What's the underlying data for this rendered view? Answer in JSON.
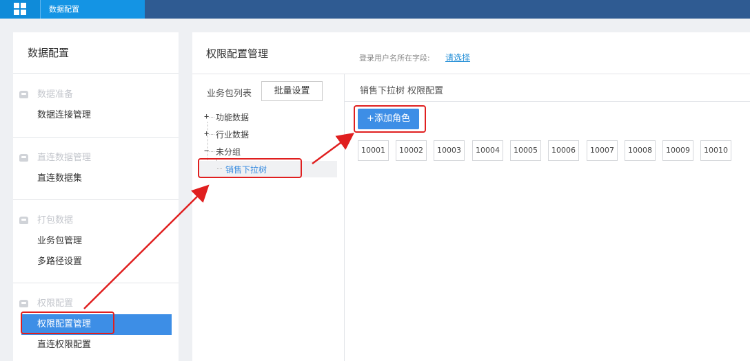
{
  "topbar": {
    "tab_label": "数据配置"
  },
  "sidebar": {
    "title": "数据配置",
    "groups": [
      {
        "header": "数据准备",
        "items": [
          "数据连接管理"
        ]
      },
      {
        "header": "直连数据管理",
        "items": [
          "直连数据集"
        ]
      },
      {
        "header": "打包数据",
        "items": [
          "业务包管理",
          "多路径设置"
        ]
      },
      {
        "header": "权限配置",
        "items": [
          "权限配置管理",
          "直连权限配置"
        ]
      }
    ]
  },
  "main": {
    "title": "权限配置管理",
    "login_field_label": "登录用户名所在字段:",
    "login_field_link": "请选择",
    "biz_list_label": "业务包列表",
    "batch_button": "批量设置",
    "tree": [
      "功能数据",
      "行业数据",
      "未分组"
    ],
    "tree_selected": "销售下拉树",
    "tree_signs": [
      "+",
      "+",
      "−"
    ],
    "right_title": "销售下拉树 权限配置",
    "add_role_button": "+添加角色",
    "roles": [
      "10001",
      "10002",
      "10003",
      "10004",
      "10005",
      "10006",
      "10007",
      "10008",
      "10009",
      "10010"
    ]
  },
  "colors": {
    "active": "#3d8ee6",
    "topbar": "#2f5b92",
    "annotation": "#e01f1f"
  }
}
